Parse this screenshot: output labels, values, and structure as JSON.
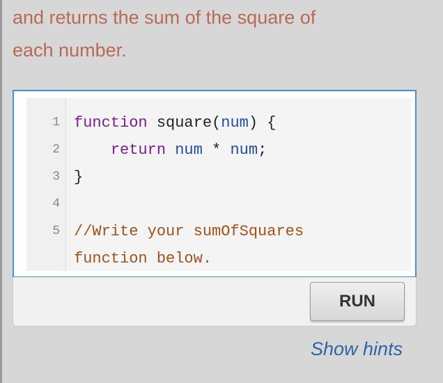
{
  "prompt": {
    "line1": "and returns the sum of the square of",
    "line2": "each number."
  },
  "editor": {
    "lines": [
      {
        "num": "1",
        "tokens": [
          {
            "t": "function",
            "c": "kw"
          },
          {
            "t": " square(",
            "c": "fn"
          },
          {
            "t": "num",
            "c": "var"
          },
          {
            "t": ") {",
            "c": "fn"
          }
        ]
      },
      {
        "num": "2",
        "tokens": [
          {
            "t": "    ",
            "c": "fn"
          },
          {
            "t": "return",
            "c": "kw"
          },
          {
            "t": " ",
            "c": "fn"
          },
          {
            "t": "num",
            "c": "var"
          },
          {
            "t": " * ",
            "c": "fn"
          },
          {
            "t": "num",
            "c": "var"
          },
          {
            "t": ";",
            "c": "fn"
          }
        ]
      },
      {
        "num": "3",
        "tokens": [
          {
            "t": "}",
            "c": "fn"
          }
        ]
      },
      {
        "num": "4",
        "tokens": []
      },
      {
        "num": "5",
        "tokens": [
          {
            "t": "//Write your sumOfSquares",
            "c": "cm"
          }
        ]
      },
      {
        "num": "",
        "tokens": [
          {
            "t": "function below.",
            "c": "cm"
          }
        ]
      }
    ]
  },
  "run_bar": {
    "run_label": "RUN"
  },
  "hints": {
    "label": "Show hints"
  },
  "colors": {
    "prompt_text": "#b96a55",
    "editor_border": "#4a90d9",
    "keyword": "#7a1f8f",
    "variable": "#1f4fa0",
    "comment": "#a0521a",
    "hint_link": "#2e64a8"
  }
}
